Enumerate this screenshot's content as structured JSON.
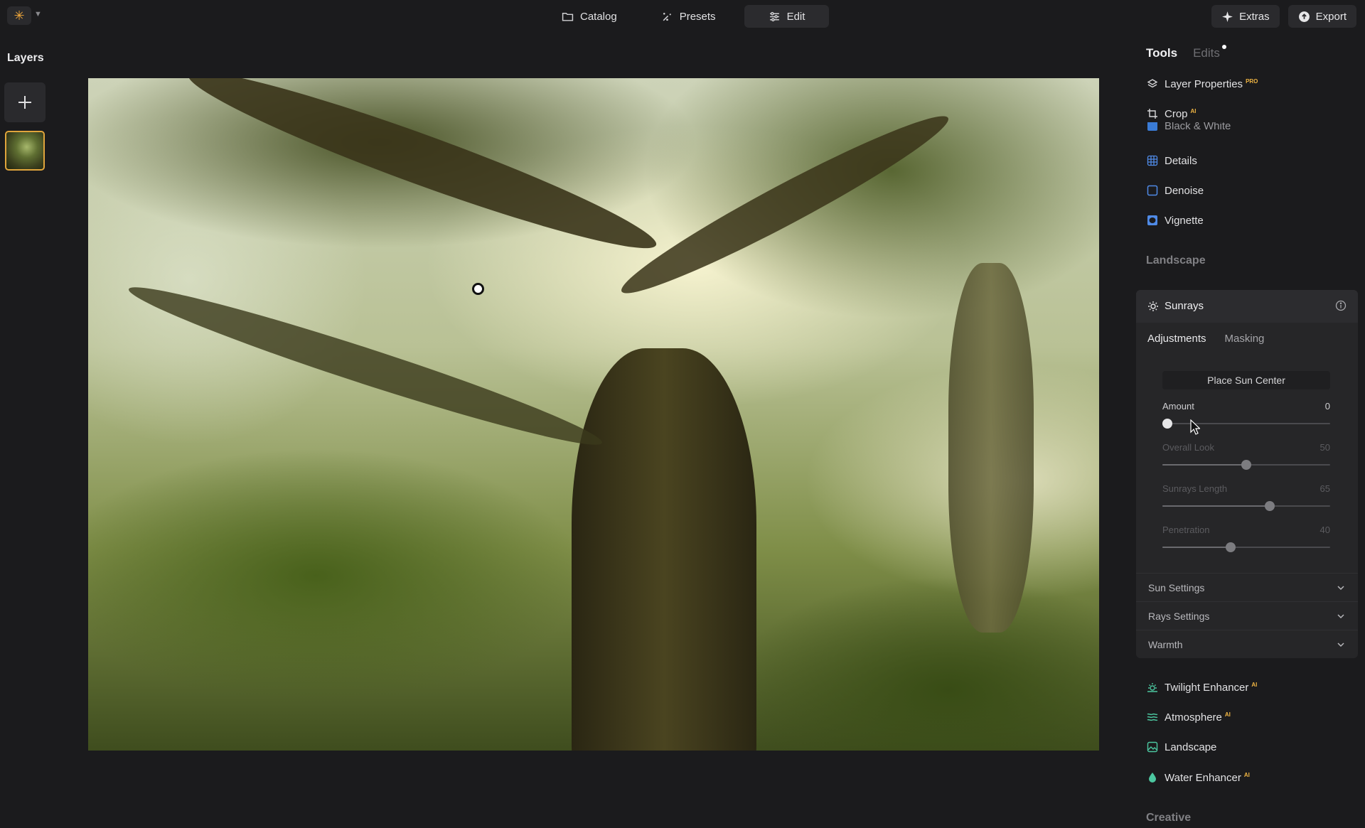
{
  "topbar": {
    "nav": [
      {
        "label": "Catalog",
        "icon": "folder-icon"
      },
      {
        "label": "Presets",
        "icon": "sparkle-icon"
      },
      {
        "label": "Edit",
        "icon": "sliders-icon",
        "active": true
      }
    ],
    "extras_label": "Extras",
    "export_label": "Export"
  },
  "layers": {
    "title": "Layers"
  },
  "panel": {
    "tab_tools": "Tools",
    "tab_edits": "Edits",
    "top_items": [
      {
        "label": "Layer Properties",
        "badge": "PRO",
        "icon": "layers-icon"
      },
      {
        "label": "Crop",
        "badge": "AI",
        "icon": "crop-icon"
      },
      {
        "label": "Black & White",
        "icon": "bw-icon"
      },
      {
        "label": "Details",
        "icon": "details-icon"
      },
      {
        "label": "Denoise",
        "icon": "denoise-icon"
      },
      {
        "label": "Vignette",
        "icon": "vignette-icon"
      }
    ],
    "section_landscape": "Landscape",
    "sunrays": {
      "title": "Sunrays",
      "tab_adjustments": "Adjustments",
      "tab_masking": "Masking",
      "place_button": "Place Sun Center",
      "sliders": [
        {
          "label": "Amount",
          "value": 0,
          "max": 100,
          "enabled": true
        },
        {
          "label": "Overall Look",
          "value": 50,
          "max": 100,
          "enabled": false
        },
        {
          "label": "Sunrays Length",
          "value": 65,
          "max": 100,
          "enabled": false
        },
        {
          "label": "Penetration",
          "value": 40,
          "max": 100,
          "enabled": false
        }
      ],
      "accordions": [
        "Sun Settings",
        "Rays Settings",
        "Warmth"
      ]
    },
    "bottom_items": [
      {
        "label": "Twilight Enhancer",
        "badge": "AI",
        "icon": "twilight-icon"
      },
      {
        "label": "Atmosphere",
        "badge": "AI",
        "icon": "atmosphere-icon"
      },
      {
        "label": "Landscape",
        "icon": "landscape-icon"
      },
      {
        "label": "Water Enhancer",
        "badge": "AI",
        "icon": "water-drop-icon"
      }
    ],
    "section_creative": "Creative"
  },
  "colors": {
    "accent": "#e0a53c",
    "panel_bg": "#1b1b1d",
    "card_bg": "#262628"
  }
}
